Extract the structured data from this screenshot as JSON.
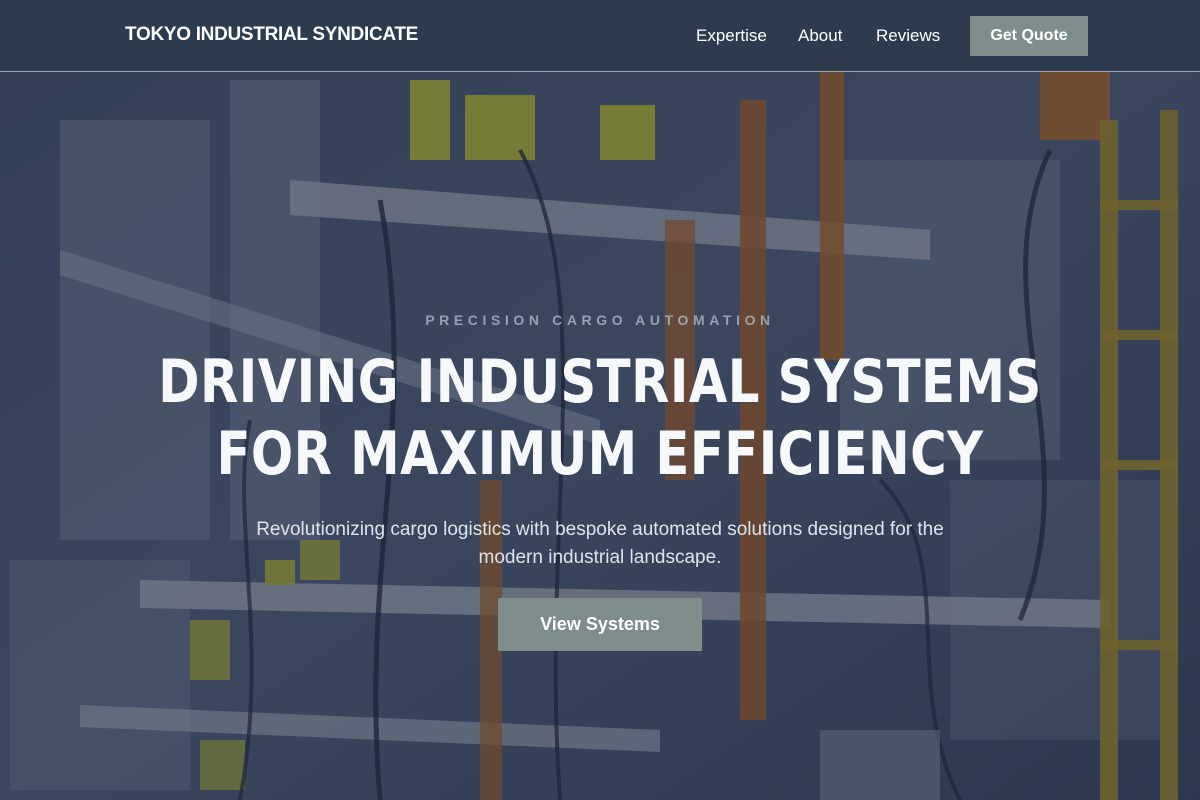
{
  "colors": {
    "nav_background": "#2c3a4e",
    "button_background": "#7e8c8c",
    "text_primary": "#ffffff",
    "eyebrow_text": "#a6afbd"
  },
  "nav": {
    "brand": "TOKYO INDUSTRIAL SYNDICATE",
    "links": [
      {
        "label": "Expertise"
      },
      {
        "label": "About"
      },
      {
        "label": "Reviews"
      }
    ],
    "cta_label": "Get Quote"
  },
  "hero": {
    "eyebrow": "PRECISION CARGO AUTOMATION",
    "headline_line1": "DRIVING INDUSTRIAL SYSTEMS",
    "headline_line2": "FOR MAXIMUM EFFICIENCY",
    "subtitle": "Revolutionizing cargo logistics with bespoke automated solutions designed for the modern industrial landscape.",
    "cta_label": "View Systems",
    "background_image": "industrial-conveyor-machinery-photo"
  }
}
